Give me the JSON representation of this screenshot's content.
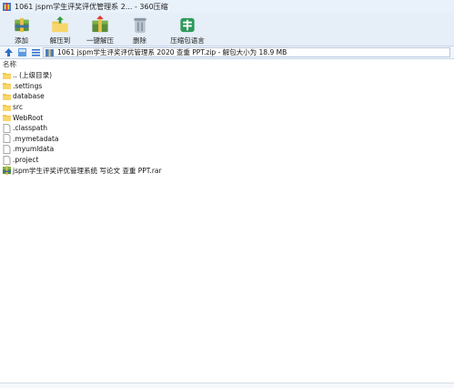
{
  "window": {
    "title": "1061 jspm学生评奖评优管理系  2... - 360压缩"
  },
  "toolbar": {
    "buttons": [
      {
        "label": "添加",
        "icon": "add-icon"
      },
      {
        "label": "解压到",
        "icon": "extract-to-icon"
      },
      {
        "label": "一键解压",
        "icon": "one-click-extract-icon"
      },
      {
        "label": "删除",
        "icon": "delete-icon"
      },
      {
        "label": "压缩包语言",
        "icon": "archive-language-icon"
      }
    ]
  },
  "pathbar": {
    "path": "1061 jspm学生评奖评优管理系  2020 查重 PPT.zip - 解包大小为 18.9 MB"
  },
  "list": {
    "column_name": "名称",
    "items": [
      {
        "name": ".. (上级目录)",
        "type": "folder"
      },
      {
        "name": ".settings",
        "type": "folder"
      },
      {
        "name": "database",
        "type": "folder"
      },
      {
        "name": "src",
        "type": "folder"
      },
      {
        "name": "WebRoot",
        "type": "folder"
      },
      {
        "name": ".classpath",
        "type": "file"
      },
      {
        "name": ".mymetadata",
        "type": "file"
      },
      {
        "name": ".myumldata",
        "type": "file"
      },
      {
        "name": ".project",
        "type": "file"
      },
      {
        "name": "jspm学生评奖评优管理系统  写论文 查重 PPT.rar",
        "type": "rar"
      }
    ]
  },
  "colors": {
    "titlebar_bg": "#e9f1fb",
    "toolbar_bg": "#e6eef8",
    "folder": "#f5c542",
    "accent": "#2a6fc9"
  }
}
